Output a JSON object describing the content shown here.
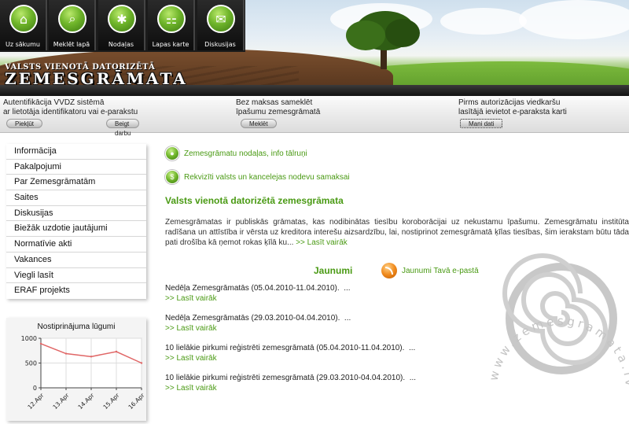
{
  "nav": [
    {
      "label": "Uz sākumu",
      "icon": "home-icon",
      "glyph": "⌂"
    },
    {
      "label": "Meklēt lapā",
      "icon": "search-icon",
      "glyph": "⌕"
    },
    {
      "label": "Nodaļas",
      "icon": "sections-icon",
      "glyph": "✱"
    },
    {
      "label": "Lapas karte",
      "icon": "sitemap-icon",
      "glyph": "⚏"
    },
    {
      "label": "Diskusijas",
      "icon": "chat-icon",
      "glyph": "✉"
    }
  ],
  "brand": {
    "subtitle": "VALSTS VIENOTĀ DATORIZĒTĀ",
    "title": "ZEMESGRĀMATA"
  },
  "info": [
    {
      "line1": "Autentifikācija VVDZ sistēmā",
      "line2": "ar lietotāja identifikatoru vai e-parakstu",
      "buttons": [
        "Piekļūt",
        "Beigt darbu"
      ]
    },
    {
      "line1": "Bez maksas sameklēt",
      "line2": "īpašumu zemesgrāmatā",
      "buttons": [
        "Meklēt"
      ]
    },
    {
      "line1": "Pirms autorizācijas viedkaršu",
      "line2": "lasītājā ievietot e-paraksta karti",
      "buttons": [
        "Mani dati"
      ]
    }
  ],
  "sidebar": {
    "items": [
      "Informācija",
      "Pakalpojumi",
      "Par Zemesgrāmatām",
      "Saites",
      "Diskusijas",
      "Biežāk uzdotie jautājumi",
      "Normatīvie akti",
      "Vakances",
      "Viegli lasīt",
      "ERAF projekts"
    ]
  },
  "chart_data": {
    "type": "line",
    "title": "Nostiprinājuma lūgumi",
    "x": [
      "12.Apr",
      "13.Apr",
      "14.Apr",
      "15.Apr",
      "16.Apr"
    ],
    "series": [
      {
        "values": [
          890,
          690,
          630,
          730,
          500
        ]
      }
    ],
    "ylim": [
      0,
      1000
    ],
    "yticks": [
      0,
      500,
      1000
    ],
    "grid": true,
    "color": "#e06666"
  },
  "main": {
    "links": [
      {
        "text": "Zemesgrāmatu nodaļas, info tālruņi",
        "icon": "globe-icon"
      },
      {
        "text": "Rekvizīti valsts un kancelejas nodevu samaksai",
        "icon": "money-icon"
      }
    ],
    "title": "Valsts vienotā datorizētā zemesgrāmata",
    "intro": "Zemesgrāmatas ir publiskās grāmatas, kas nodibinātas tiesību koroborācijai uz nekustamu īpašumu. Zemesgrāmatu institūta radīšana un attīstība ir vērsta uz kreditora interešu aizsardzību, lai, nostiprinot zemesgrāmatā ķīlas tiesības, šim ierakstam būtu tāda pati drošība kā ņemot rokas ķīlā ku...",
    "intro_more": ">> Lasīt vairāk",
    "news_title": "Jaunumi",
    "rss_label": "Jaunumi Tavā e-pastā",
    "news": [
      {
        "text": "Nedēļa Zemesgrāmatās (05.04.2010-11.04.2010).",
        "ellipsis": "...",
        "more": ">> Lasīt vairāk"
      },
      {
        "text": "Nedēļa Zemesgrāmatās (29.03.2010-04.04.2010).",
        "ellipsis": "...",
        "more": ">> Lasīt vairāk"
      },
      {
        "text": "10 lielākie pirkumi reģistrēti zemesgrāmatā (05.04.2010-11.04.2010).",
        "ellipsis": "...",
        "more": ">> Lasīt vairāk"
      },
      {
        "text": "10 lielākie pirkumi reģistrēti zemesgrāmatā (29.03.2010-04.04.2010).",
        "ellipsis": "...",
        "more": ">> Lasīt vairāk"
      }
    ],
    "watermark": "www.zemesgramata.lv"
  }
}
